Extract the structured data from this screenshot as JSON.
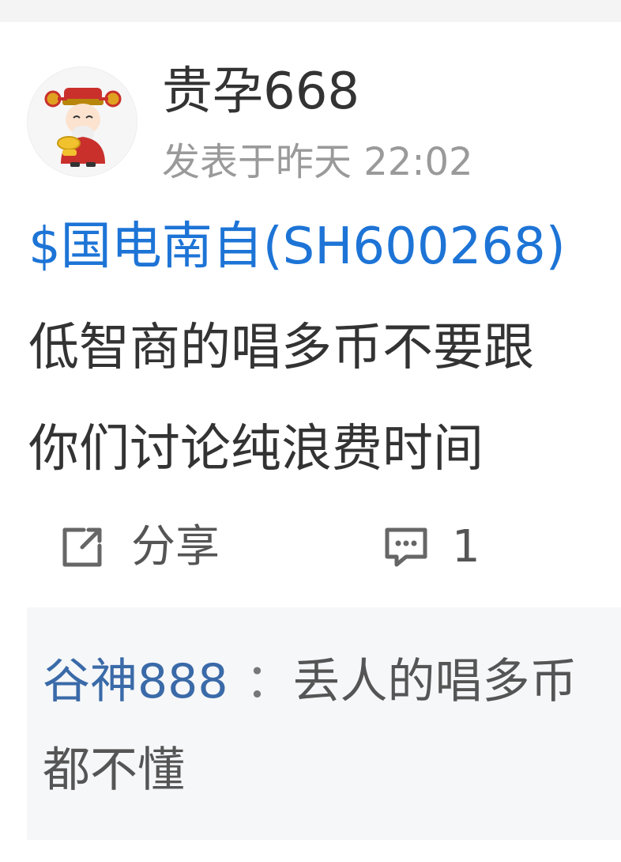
{
  "post": {
    "username": "贵孕668",
    "time": "发表于昨天 22:02",
    "stock_tag": "$国电南自(SH600268)",
    "content_line1": "低智商的唱多币不要跟",
    "content_line2": "你们讨论纯浪费时间"
  },
  "actions": {
    "share_label": "分享",
    "comment_count": "1"
  },
  "comment": {
    "author": "谷神888",
    "separator": "：",
    "text_line1": "丢人的唱多币",
    "text_line2": "都不懂"
  },
  "colors": {
    "link_blue": "#1d74d6",
    "commenter_blue": "#3a6aa8",
    "muted_gray": "#9a9a9a",
    "comment_bg": "#f6f7f9"
  },
  "icons": {
    "avatar": "god-of-wealth-avatar",
    "share": "share-external-icon",
    "comment": "comment-bubble-icon"
  }
}
